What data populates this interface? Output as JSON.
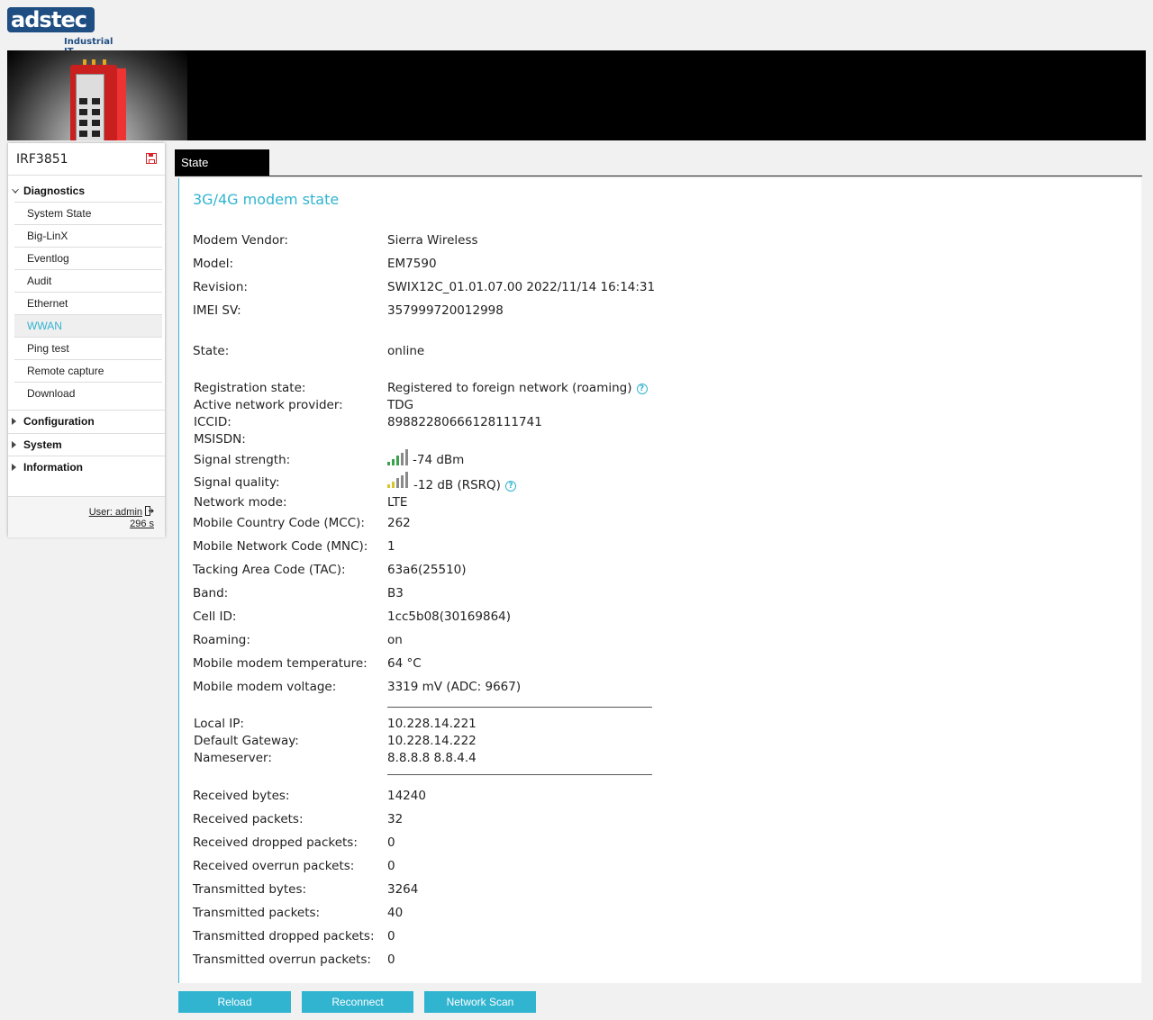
{
  "brand": {
    "logo_left": "ads",
    "logo_right": "tec",
    "tagline": "Industrial IT",
    "primary_color": "#1e4e82",
    "accent_color": "#31b4d0"
  },
  "sidebar": {
    "device_name": "IRF3851",
    "groups": [
      {
        "label": "Diagnostics",
        "expanded": true,
        "items": [
          "System State",
          "Big-LinX",
          "Eventlog",
          "Audit",
          "Ethernet",
          "WWAN",
          "Ping test",
          "Remote capture",
          "Download"
        ],
        "active_item": "WWAN"
      },
      {
        "label": "Configuration",
        "expanded": false
      },
      {
        "label": "System",
        "expanded": false
      },
      {
        "label": "Information",
        "expanded": false
      }
    ],
    "user": "User: admin",
    "session_time": "296 s"
  },
  "tabs": [
    {
      "label": "State",
      "active": true
    }
  ],
  "modem": {
    "title": "3G/4G modem state",
    "vendor": {
      "label": "Modem Vendor:",
      "value": "Sierra Wireless"
    },
    "model": {
      "label": "Model:",
      "value": "EM7590"
    },
    "revision": {
      "label": "Revision:",
      "value": "SWIX12C_01.01.07.00 2022/11/14 16:14:31"
    },
    "imei": {
      "label": "IMEI SV:",
      "value": "357999720012998"
    },
    "state": {
      "label": "State:",
      "value": "online"
    },
    "registration": {
      "label": "Registration state:",
      "value": "Registered to foreign network (roaming)"
    },
    "provider": {
      "label": "Active network provider:",
      "value": "TDG"
    },
    "iccid": {
      "label": "ICCID:",
      "value": "89882280666128111741"
    },
    "msisdn": {
      "label": "MSISDN:",
      "value": ""
    },
    "signal_strength": {
      "label": "Signal strength:",
      "value": "-74 dBm",
      "bars_level": 3
    },
    "signal_quality": {
      "label": "Signal quality:",
      "value": "-12 dB (RSRQ)",
      "bars_level": 2
    },
    "network_mode": {
      "label": "Network mode:",
      "value": "LTE"
    },
    "mcc": {
      "label": "Mobile Country Code (MCC):",
      "value": "262"
    },
    "mnc": {
      "label": "Mobile Network Code (MNC):",
      "value": "1"
    },
    "tac": {
      "label": "Tacking Area Code (TAC):",
      "value": "63a6(25510)"
    },
    "band": {
      "label": "Band:",
      "value": "B3"
    },
    "cell_id": {
      "label": "Cell ID:",
      "value": "1cc5b08(30169864)"
    },
    "roaming": {
      "label": "Roaming:",
      "value": "on"
    },
    "temperature": {
      "label": "Mobile modem temperature:",
      "value": "64 °C"
    },
    "voltage": {
      "label": "Mobile modem voltage:",
      "value": "3319 mV (ADC: 9667)"
    },
    "local_ip": {
      "label": "Local IP:",
      "value": "10.228.14.221"
    },
    "gateway": {
      "label": "Default Gateway:",
      "value": "10.228.14.222"
    },
    "nameserver": {
      "label": "Nameserver:",
      "value": "8.8.8.8 8.8.4.4"
    },
    "rx_bytes": {
      "label": "Received bytes:",
      "value": "14240"
    },
    "rx_packets": {
      "label": "Received packets:",
      "value": "32"
    },
    "rx_dropped": {
      "label": "Received dropped packets:",
      "value": "0"
    },
    "rx_overrun": {
      "label": "Received overrun packets:",
      "value": "0"
    },
    "tx_bytes": {
      "label": "Transmitted bytes:",
      "value": "3264"
    },
    "tx_packets": {
      "label": "Transmitted packets:",
      "value": "40"
    },
    "tx_dropped": {
      "label": "Transmitted dropped packets:",
      "value": "0"
    },
    "tx_overrun": {
      "label": "Transmitted overrun packets:",
      "value": "0"
    }
  },
  "buttons": {
    "reload": "Reload",
    "reconnect": "Reconnect",
    "network_scan": "Network Scan"
  }
}
